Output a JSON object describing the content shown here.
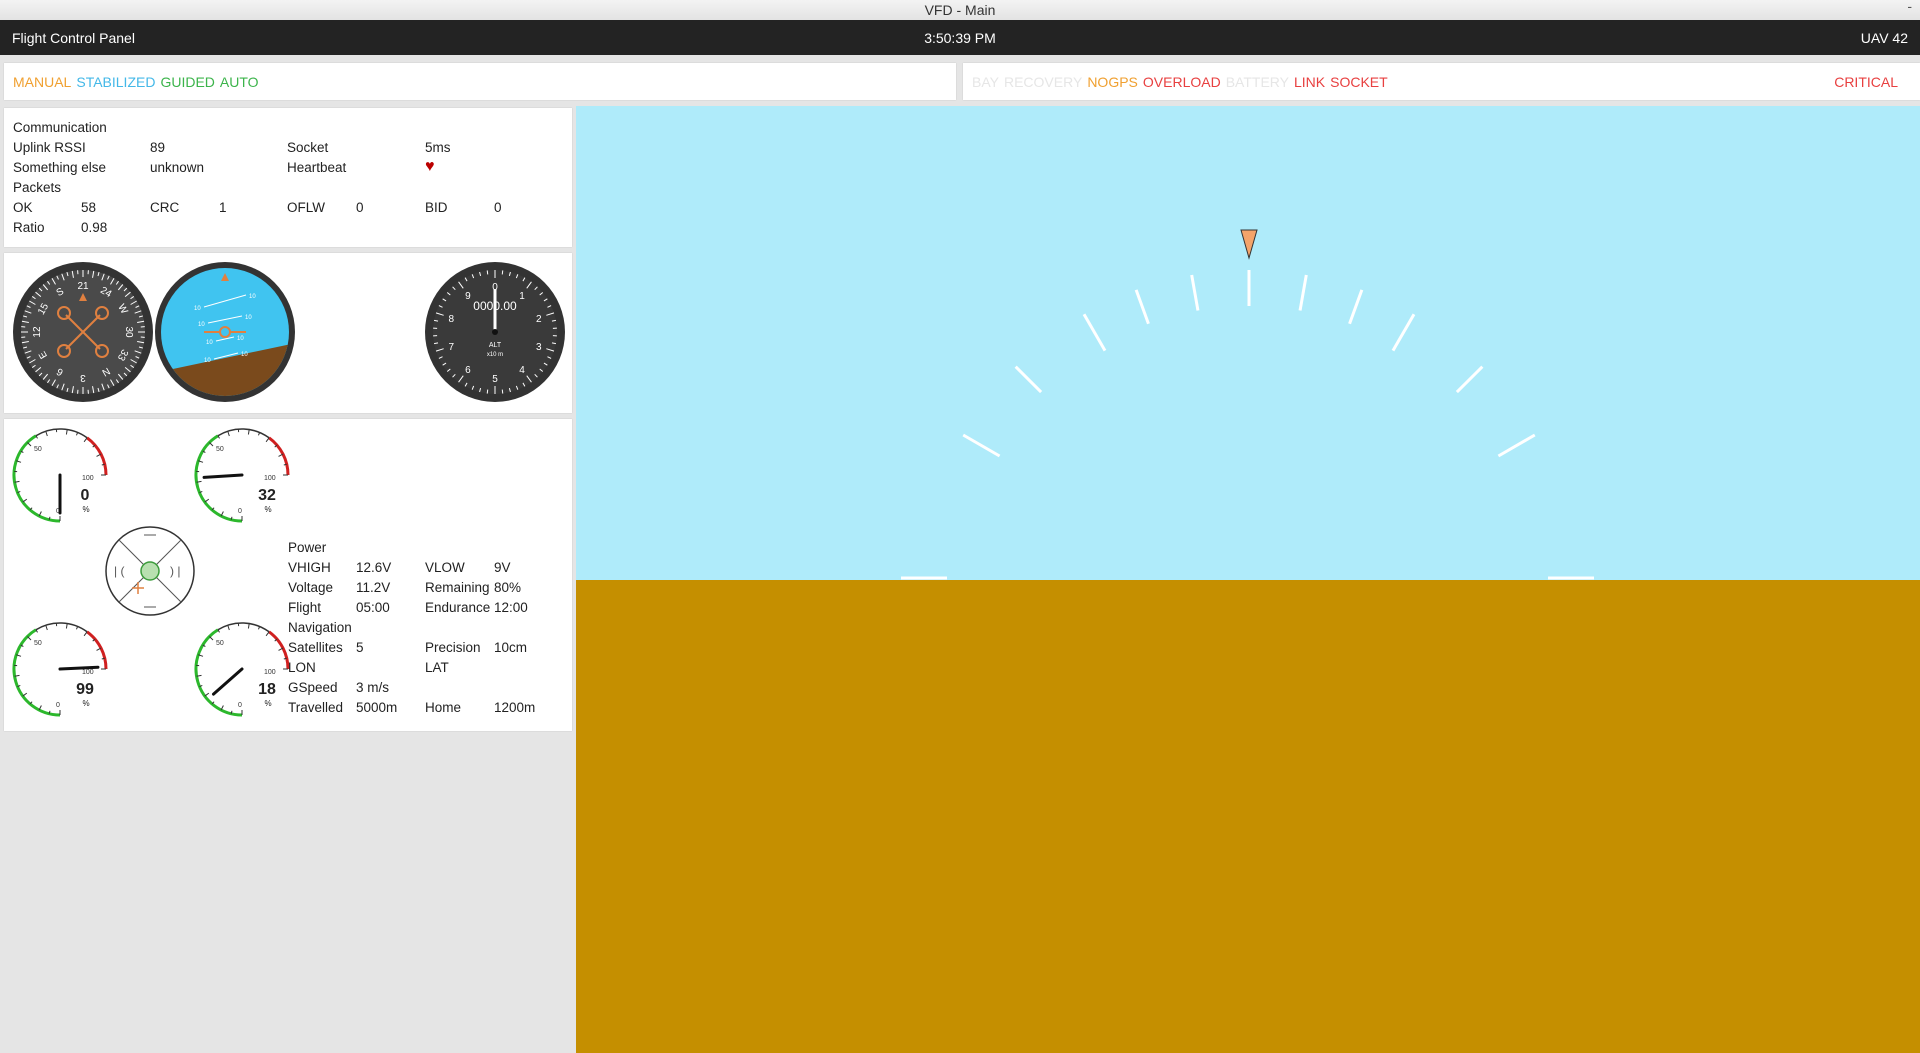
{
  "window": {
    "title": "VFD - Main",
    "minimize_glyph": "-"
  },
  "header": {
    "app_title": "Flight Control Panel",
    "clock": "3:50:39 PM",
    "vehicle": "UAV 42"
  },
  "modes": [
    {
      "label": "MANUAL",
      "color": "#f0a030"
    },
    {
      "label": "STABILIZED",
      "color": "#44b8e8"
    },
    {
      "label": "GUIDED",
      "color": "#3cb44b"
    },
    {
      "label": "AUTO",
      "color": "#3cb44b"
    }
  ],
  "alerts": [
    {
      "label": "BAY",
      "color": "#e6e6e6"
    },
    {
      "label": "RECOVERY",
      "color": "#e6e6e6"
    },
    {
      "label": "NOGPS",
      "color": "#f0a030"
    },
    {
      "label": "OVERLOAD",
      "color": "#e84040"
    },
    {
      "label": "BATTERY",
      "color": "#e6e6e6"
    },
    {
      "label": "LINK",
      "color": "#e84040"
    },
    {
      "label": "SOCKET",
      "color": "#e84040"
    }
  ],
  "alert_level": {
    "label": "CRITICAL",
    "color": "#e84040"
  },
  "communication": {
    "heading": "Communication",
    "uplink_rssi_label": "Uplink RSSI",
    "uplink_rssi": "89",
    "socket_label": "Socket",
    "socket": "5ms",
    "something_label": "Something else",
    "something": "unknown",
    "heartbeat_label": "Heartbeat",
    "heartbeat_icon": "heart-icon",
    "packets_heading": "Packets",
    "ok_label": "OK",
    "ok": "58",
    "crc_label": "CRC",
    "crc": "1",
    "oflw_label": "OFLW",
    "oflw": "0",
    "bid_label": "BID",
    "bid": "0",
    "ratio_label": "Ratio",
    "ratio": "0.98"
  },
  "instruments": {
    "heading_labels": [
      "21",
      "24",
      "W",
      "30",
      "33",
      "N",
      "3",
      "6",
      "E",
      "12",
      "15",
      "S"
    ],
    "attitude_pitch_labels": [
      "10",
      "10",
      "10",
      "10",
      "10",
      "10",
      "10",
      "10"
    ],
    "altimeter": {
      "digits": [
        "0",
        "1",
        "2",
        "3",
        "4",
        "5",
        "6",
        "7",
        "8",
        "9"
      ],
      "readout": "0000.00",
      "label": "ALT",
      "sublabel": "x10 m"
    }
  },
  "dials": [
    {
      "id": "g1",
      "value": "0",
      "fraction": 0.0,
      "unit": "%",
      "label_mid": "50",
      "label_max": "100",
      "label_min": "0"
    },
    {
      "id": "g2",
      "value": "32",
      "fraction": 0.32,
      "unit": "%",
      "label_mid": "50",
      "label_max": "100",
      "label_min": "0"
    },
    {
      "id": "g3",
      "value": "99",
      "fraction": 0.99,
      "unit": "%",
      "label_mid": "50",
      "label_max": "100",
      "label_min": "0"
    },
    {
      "id": "g4",
      "value": "18",
      "fraction": 0.18,
      "unit": "%",
      "label_mid": "50",
      "label_max": "100",
      "label_min": "0"
    }
  ],
  "power": {
    "heading": "Power",
    "vhigh_label": "VHIGH",
    "vhigh": "12.6V",
    "vlow_label": "VLOW",
    "vlow": "9V",
    "voltage_label": "Voltage",
    "voltage": "11.2V",
    "remaining_label": "Remaining",
    "remaining": "80%",
    "flight_label": "Flight",
    "flight": "05:00",
    "endurance_label": "Endurance",
    "endurance": "12:00"
  },
  "navigation": {
    "heading": "Navigation",
    "satellites_label": "Satellites",
    "satellites": "5",
    "precision_label": "Precision",
    "precision": "10cm",
    "lon_label": "LON",
    "lat_label": "LAT",
    "gspeed_label": "GSpeed",
    "gspeed": "3 m/s",
    "travelled_label": "Travelled",
    "travelled": "5000m",
    "home_label": "Home",
    "home": "1200m"
  },
  "horizon_view": {
    "sky_color": "#afebfa",
    "ground_color": "#c58f00",
    "pointer_color": "#f4a46a"
  }
}
